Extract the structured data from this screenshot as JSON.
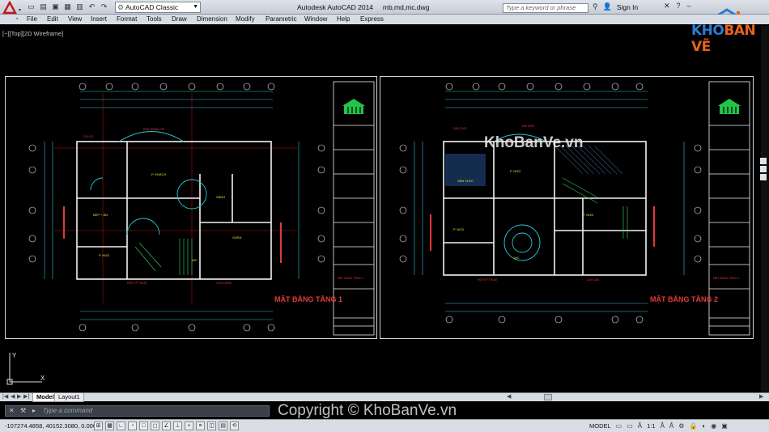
{
  "app": {
    "title": "Autodesk AutoCAD 2014",
    "file": "mb,md,mc.dwg",
    "workspace": "AutoCAD Classic",
    "search_placeholder": "Type a keyword or phrase",
    "sign_in": "Sign In"
  },
  "menu": [
    "File",
    "Edit",
    "View",
    "Insert",
    "Format",
    "Tools",
    "Draw",
    "Dimension",
    "Modify",
    "Parametric",
    "Window",
    "Help",
    "Express"
  ],
  "viewport_label": "[−][Top][2D Wireframe]",
  "brand": {
    "part1": "KHO",
    "part2": "BẢN VẼ"
  },
  "watermark": "KhoBanVe.vn",
  "copyright": "Copyright © KhoBanVe.vn",
  "sheets": [
    {
      "plan_title": "MẶT BẰNG TẦNG 1",
      "scale": "TỶ LỆ 1/100"
    },
    {
      "plan_title": "MẶT BẰNG TẦNG 2",
      "scale": "TỶ LỆ 1/100"
    }
  ],
  "tabs": {
    "model": "Model",
    "layout": "Layout1"
  },
  "command": {
    "placeholder": "Type a command"
  },
  "status": {
    "coords": "-107274.4858, 40152.3080, 0.0000",
    "mode": "MODEL",
    "scale": "1:1"
  },
  "colors": {
    "accent_red": "#d01010",
    "wall_white": "#f2f2f2",
    "dim_cyan": "#27c6d6",
    "text_yellow": "#e8e23a",
    "label_red": "#e23a3a",
    "stair_green": "#2fbf5a",
    "brand_blue": "#2b7bd1",
    "brand_orange": "#e8611c"
  }
}
